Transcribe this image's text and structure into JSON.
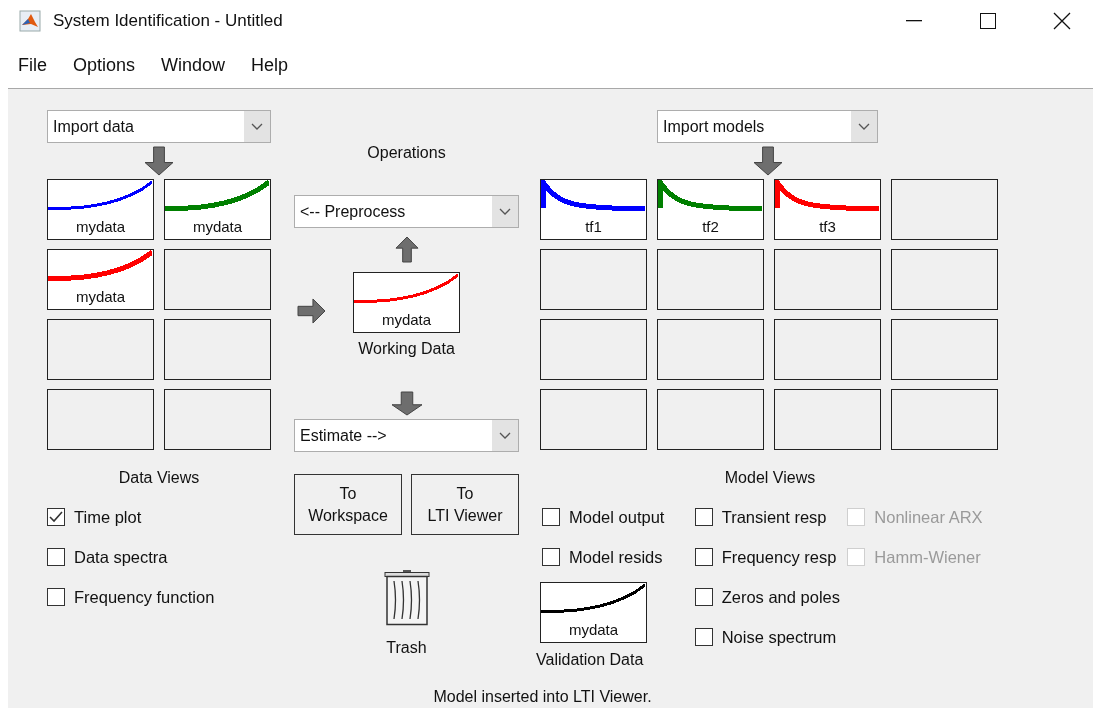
{
  "window": {
    "title": "System Identification - Untitled"
  },
  "menu": [
    "File",
    "Options",
    "Window",
    "Help"
  ],
  "data_board": {
    "dropdown": {
      "value": "Import data"
    },
    "tiles": [
      {
        "kind": "data",
        "label": "mydata",
        "color": "#0000ff",
        "thick": false
      },
      {
        "kind": "data",
        "label": "mydata",
        "color": "#008000",
        "thick": true
      },
      {
        "kind": "data",
        "label": "mydata",
        "color": "#ff0000",
        "thick": true
      },
      {
        "kind": "empty"
      },
      {
        "kind": "empty"
      },
      {
        "kind": "empty"
      },
      {
        "kind": "empty"
      },
      {
        "kind": "empty"
      }
    ],
    "views_label": "Data Views",
    "checkboxes": [
      {
        "label": "Time plot",
        "checked": true,
        "disabled": false
      },
      {
        "label": "Data spectra",
        "checked": false,
        "disabled": false
      },
      {
        "label": "Frequency function",
        "checked": false,
        "disabled": false
      }
    ]
  },
  "operations": {
    "label": "Operations",
    "preprocess": {
      "value": "<-- Preprocess"
    },
    "working_data": {
      "tile": {
        "kind": "data",
        "label": "mydata",
        "color": "#ff0000",
        "thick": false
      },
      "caption": "Working Data"
    },
    "estimate": {
      "value": "Estimate -->"
    },
    "buttons": [
      {
        "lines": [
          "To",
          "Workspace"
        ]
      },
      {
        "lines": [
          "To",
          "LTI Viewer"
        ]
      }
    ],
    "trash": {
      "label": "Trash"
    }
  },
  "model_board": {
    "dropdown": {
      "value": "Import models"
    },
    "tiles": [
      {
        "kind": "model",
        "label": "tf1",
        "color": "#0000ff",
        "thick": true
      },
      {
        "kind": "model",
        "label": "tf2",
        "color": "#008000",
        "thick": true
      },
      {
        "kind": "model",
        "label": "tf3",
        "color": "#ff0000",
        "thick": true
      },
      {
        "kind": "empty"
      },
      {
        "kind": "empty"
      },
      {
        "kind": "empty"
      },
      {
        "kind": "empty"
      },
      {
        "kind": "empty"
      },
      {
        "kind": "empty"
      },
      {
        "kind": "empty"
      },
      {
        "kind": "empty"
      },
      {
        "kind": "empty"
      },
      {
        "kind": "empty"
      },
      {
        "kind": "empty"
      },
      {
        "kind": "empty"
      },
      {
        "kind": "empty"
      }
    ],
    "views_label": "Model Views",
    "checkbox_columns": [
      [
        {
          "label": "Model output",
          "checked": false,
          "disabled": false
        },
        {
          "label": "Model resids",
          "checked": false,
          "disabled": false
        }
      ],
      [
        {
          "label": "Transient resp",
          "checked": false,
          "disabled": false
        },
        {
          "label": "Frequency resp",
          "checked": false,
          "disabled": false
        },
        {
          "label": "Zeros and poles",
          "checked": false,
          "disabled": false
        },
        {
          "label": "Noise spectrum",
          "checked": false,
          "disabled": false
        }
      ],
      [
        {
          "label": "Nonlinear ARX",
          "checked": false,
          "disabled": true
        },
        {
          "label": "Hamm-Wiener",
          "checked": false,
          "disabled": true
        }
      ]
    ],
    "validation_data": {
      "tile": {
        "kind": "data",
        "label": "mydata",
        "color": "#000000",
        "thick": false
      },
      "caption": "Validation Data"
    }
  },
  "status_bar": "Model inserted into LTI Viewer."
}
